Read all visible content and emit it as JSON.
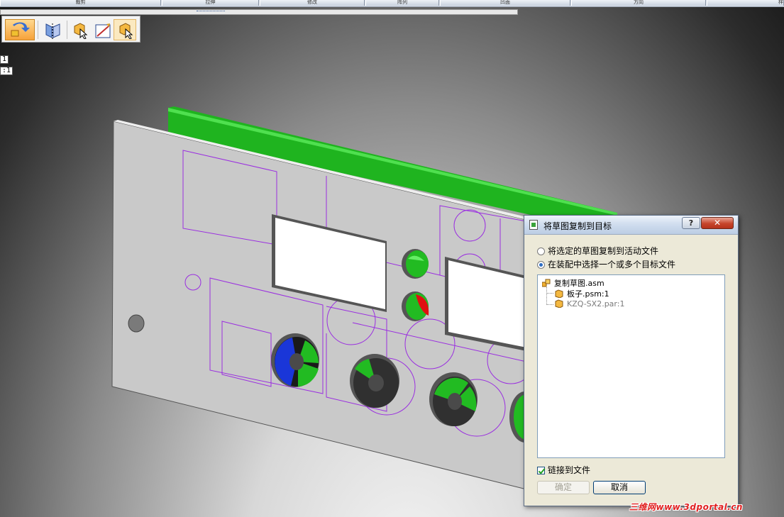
{
  "ribbon": {
    "tabs": [
      {
        "label": "裁剪"
      },
      {
        "label": "拉伸"
      },
      {
        "label": "修改"
      },
      {
        "label": "阵列"
      },
      {
        "label": "凹面"
      },
      {
        "label": "方向"
      },
      {
        "label": "样"
      }
    ]
  },
  "toolbar": {
    "buttons": [
      {
        "icon": "copy-sketch-icon"
      },
      {
        "icon": "sketch-plane-icon"
      },
      {
        "icon": "select-part-icon"
      },
      {
        "icon": "draw-line-icon"
      },
      {
        "icon": "select-target-icon"
      }
    ]
  },
  "viewport_tags": {
    "tag1": "1",
    "tag2": ":1"
  },
  "dialog": {
    "title": "将草图复制到目标",
    "help_label": "?",
    "close_label": "✕",
    "options": [
      {
        "label": "将选定的草图复制到活动文件",
        "selected": false
      },
      {
        "label": "在装配中选择一个或多个目标文件",
        "selected": true
      }
    ],
    "tree": {
      "root": {
        "label": "复制草图.asm",
        "icon": "assembly-icon"
      },
      "children": [
        {
          "label": "板子.psm:1",
          "icon": "sheetmetal-part-icon",
          "dimmed": false
        },
        {
          "label": "KZQ-SX2.par:1",
          "icon": "part-icon",
          "dimmed": true
        }
      ]
    },
    "link_checkbox": {
      "label": "链接到文件",
      "checked": true
    },
    "ok_label": "确定",
    "cancel_label": "取消"
  },
  "watermark": "三维网www.3dportal.cn",
  "colors": {
    "panel": "#c8c8c8",
    "board": "#22bb22",
    "sketch": "#9a2ee0",
    "accent": "#f6a23a"
  }
}
